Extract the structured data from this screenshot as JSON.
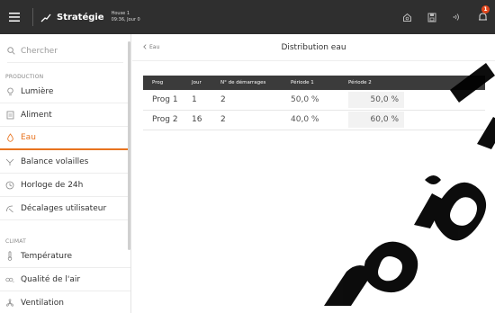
{
  "topbar": {
    "app_title": "Stratégie",
    "house_name": "House 1",
    "house_time": "09:36, Jour 0",
    "bell_count": "1"
  },
  "sidebar": {
    "search_placeholder": "Chercher",
    "sections": [
      {
        "label": "PRODUCTION",
        "items": [
          {
            "label": "Lumière",
            "icon": "bulb-icon",
            "active": false
          },
          {
            "label": "Aliment",
            "icon": "feeder-icon",
            "active": false
          },
          {
            "label": "Eau",
            "icon": "water-drop-icon",
            "active": true
          },
          {
            "label": "Balance volailles",
            "icon": "scale-icon",
            "active": false
          },
          {
            "label": "Horloge de 24h",
            "icon": "clock-icon",
            "active": false
          },
          {
            "label": "Décalages utilisateur",
            "icon": "shift-icon",
            "active": false
          }
        ]
      },
      {
        "label": "CLIMAT",
        "items": [
          {
            "label": "Température",
            "icon": "thermometer-icon",
            "active": false
          },
          {
            "label": "Qualité de l'air",
            "icon": "co2-icon",
            "active": false
          },
          {
            "label": "Ventilation",
            "icon": "fan-icon",
            "active": false
          }
        ]
      }
    ]
  },
  "main": {
    "back_label": "Eau",
    "title": "Distribution eau",
    "table": {
      "headers": [
        "Prog",
        "Jour",
        "N° de démarrages",
        "Période 1",
        "Période 2"
      ],
      "rows": [
        [
          "Prog 1",
          "1",
          "2",
          "50,0 %",
          "50,0 %"
        ],
        [
          "Prog 2",
          "16",
          "2",
          "40,0 %",
          "60,0 %"
        ]
      ]
    }
  },
  "colors": {
    "topbar": "#2f2f2f",
    "accent": "#e8731f",
    "table_header": "#3b3b3b",
    "badge": "#e2461c"
  }
}
